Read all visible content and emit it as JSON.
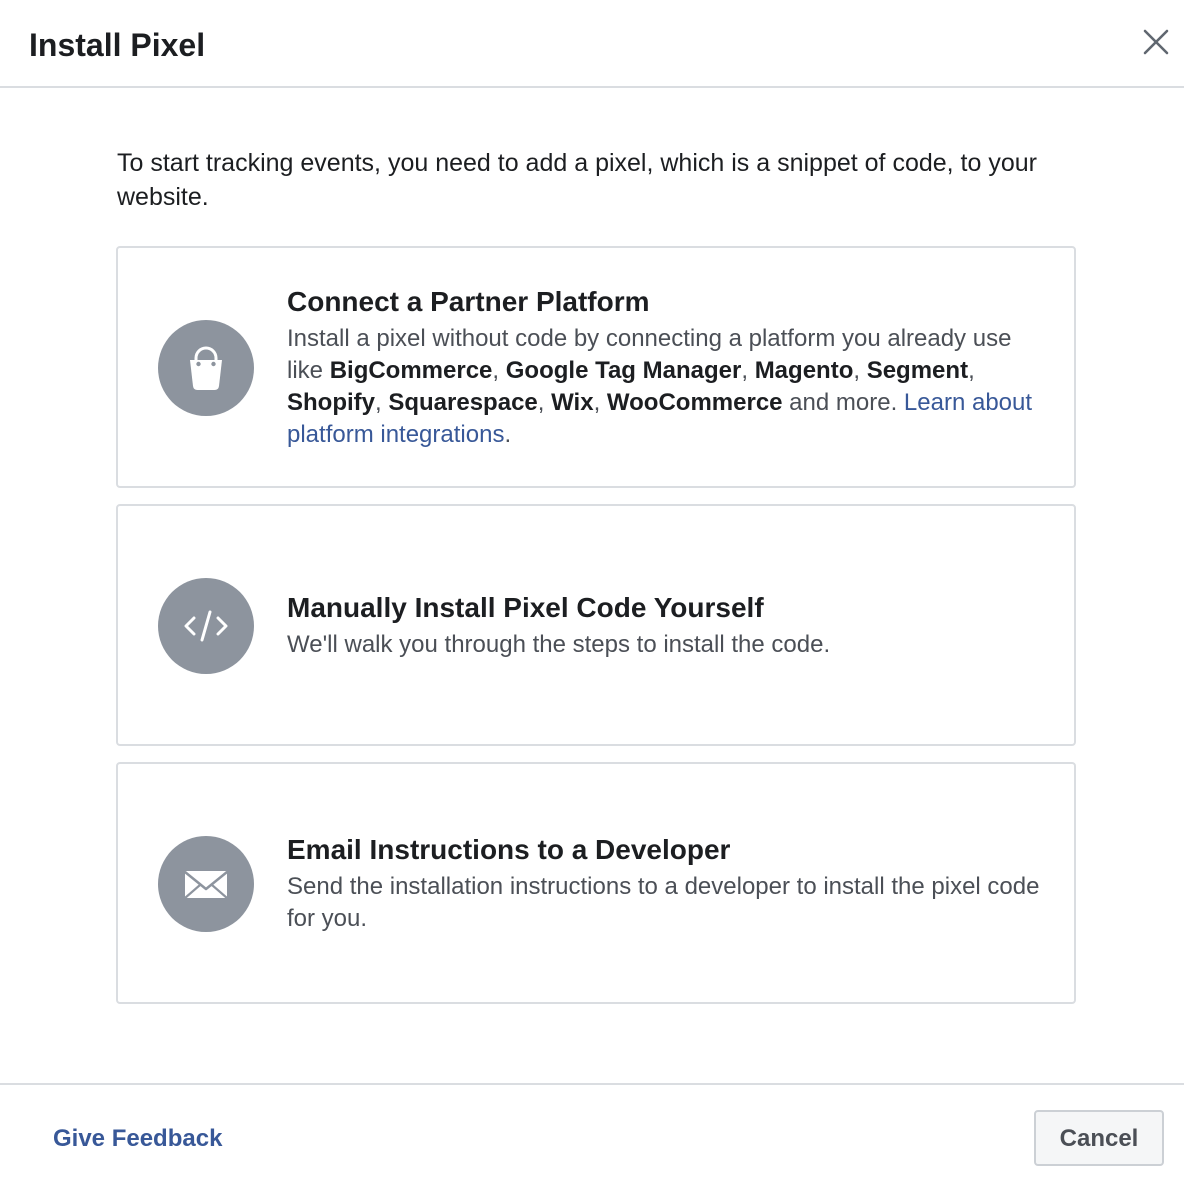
{
  "dialog": {
    "title": "Install Pixel",
    "close_icon": "close-icon",
    "intro": "To start tracking events, you need to add a pixel, which is a snippet of code, to your website."
  },
  "options": [
    {
      "icon": "shopping-bag-icon",
      "title": "Connect a Partner Platform",
      "desc_prefix": "Install a pixel without code by connecting a platform you already use like ",
      "platforms": [
        "BigCommerce",
        "Google Tag Manager",
        "Magento",
        "Segment",
        "Shopify",
        "Squarespace",
        "Wix",
        "WooCommerce"
      ],
      "sep": ", ",
      "desc_suffix": " and more.",
      "link_text": "Learn about platform integrations",
      "link_suffix": "."
    },
    {
      "icon": "code-icon",
      "title": "Manually Install Pixel Code Yourself",
      "desc": "We'll walk you through the steps to install the code."
    },
    {
      "icon": "envelope-icon",
      "title": "Email Instructions to a Developer",
      "desc": "Send the installation instructions to a developer to install the pixel code for you."
    }
  ],
  "footer": {
    "feedback_label": "Give Feedback",
    "cancel_label": "Cancel"
  },
  "colors": {
    "link": "#385898",
    "icon_circle": "#8d949e",
    "border": "#dadde1"
  }
}
